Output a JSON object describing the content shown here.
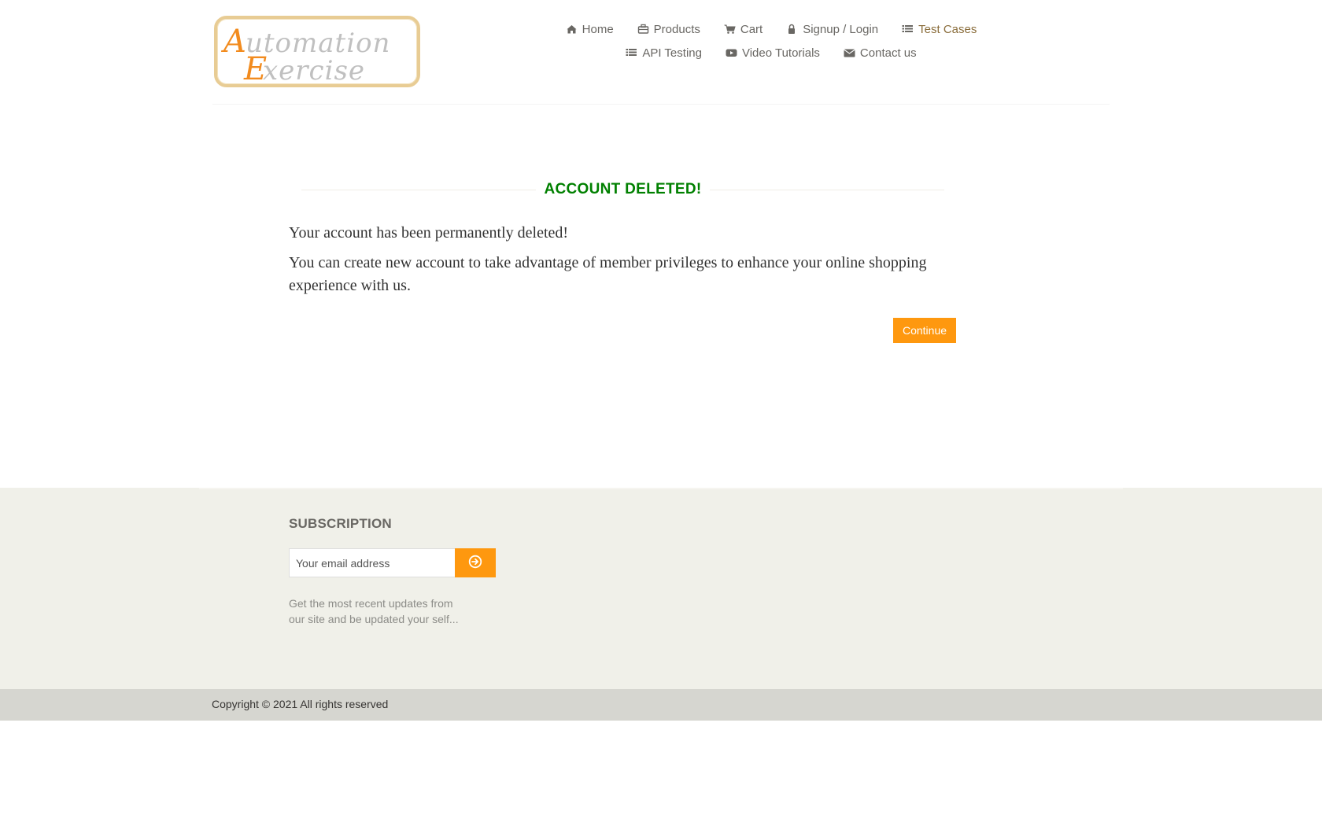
{
  "header": {
    "logo": {
      "word1": "Automation",
      "word2": "Exercise"
    },
    "nav": [
      {
        "label": "Home",
        "icon": "home-icon"
      },
      {
        "label": "Products",
        "icon": "briefcase-icon"
      },
      {
        "label": "Cart",
        "icon": "cart-icon"
      },
      {
        "label": "Signup / Login",
        "icon": "lock-icon"
      },
      {
        "label": "Test Cases",
        "icon": "list-icon"
      },
      {
        "label": "API Testing",
        "icon": "list-icon"
      },
      {
        "label": "Video Tutorials",
        "icon": "youtube-icon"
      },
      {
        "label": "Contact us",
        "icon": "envelope-icon"
      }
    ]
  },
  "main": {
    "title": "ACCOUNT DELETED!",
    "message1": "Your account has been permanently deleted!",
    "message2": "You can create new account to take advantage of member privileges to enhance your online shopping experience with us.",
    "continue_label": "Continue"
  },
  "footer": {
    "subscription_title": "SUBSCRIPTION",
    "email_placeholder": "Your email address",
    "subscribe_icon": "arrow-circle-right-icon",
    "description": "Get the most recent updates from our site and be updated your self...",
    "copyright": "Copyright © 2021 All rights reserved"
  },
  "colors": {
    "accent": "#fe980f",
    "title_green": "#008000",
    "footer_bg": "#f0f0e9",
    "copyright_bg": "#d6d6d0",
    "text": "#696763"
  }
}
